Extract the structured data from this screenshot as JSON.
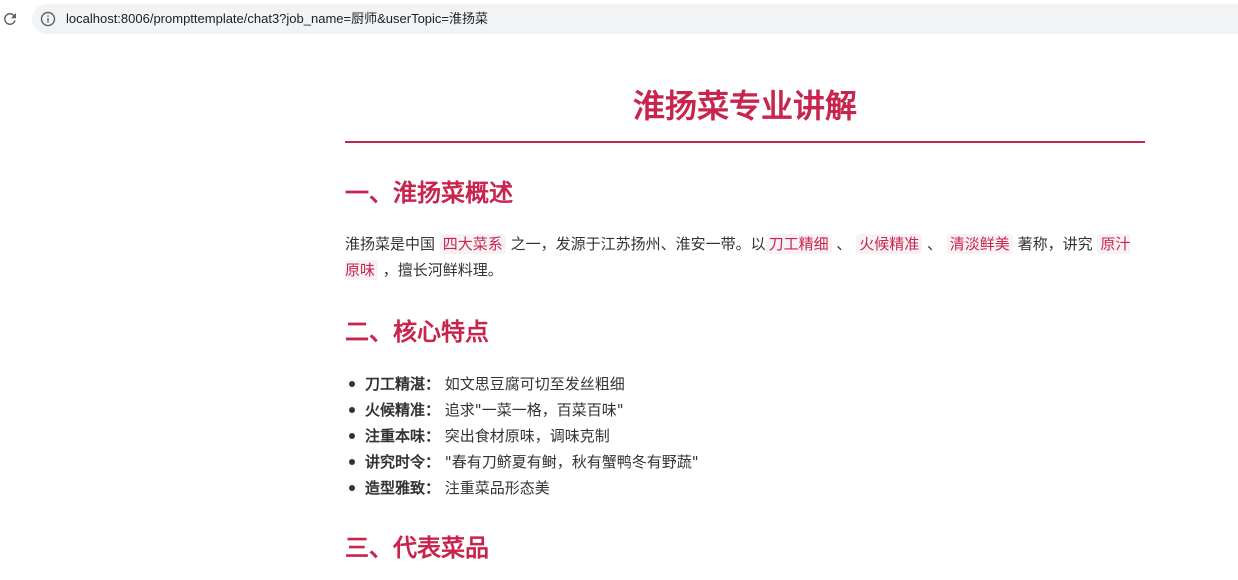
{
  "browser": {
    "url": "localhost:8006/prompttemplate/chat3?job_name=厨师&userTopic=淮扬菜",
    "icons": {
      "reload": "reload-icon",
      "info": "info-icon"
    }
  },
  "article": {
    "title": "淮扬菜专业讲解",
    "sections": {
      "overview": {
        "heading": "一、淮扬菜概述",
        "text_1": "淮扬菜是中国",
        "hl_1": "四大菜系",
        "text_2": "之一，发源于江苏扬州、淮安一带。以",
        "hl_2": "刀工精细",
        "sep_1": "、",
        "hl_3": "火候精准",
        "sep_2": "、",
        "hl_4": "清淡鲜美",
        "text_3": "著称，讲究",
        "hl_5": "原汁原味",
        "text_4": "，擅长河鲜料理。"
      },
      "features": {
        "heading": "二、核心特点",
        "items": [
          {
            "term": "刀工精湛：",
            "desc": "如文思豆腐可切至发丝粗细"
          },
          {
            "term": "火候精准：",
            "desc": "追求\"一菜一格，百菜百味\""
          },
          {
            "term": "注重本味：",
            "desc": "突出食材原味，调味克制"
          },
          {
            "term": "讲究时令：",
            "desc": "\"春有刀鲚夏有鲥，秋有蟹鸭冬有野蔬\""
          },
          {
            "term": "造型雅致：",
            "desc": "注重菜品形态美"
          }
        ]
      },
      "dishes": {
        "heading": "三、代表菜品"
      }
    },
    "colors": {
      "accent": "#c7254e",
      "highlight_bg": "#f9f2f4",
      "text": "#333333"
    }
  }
}
